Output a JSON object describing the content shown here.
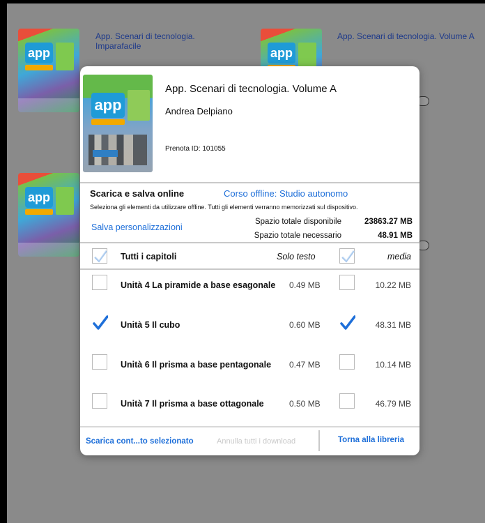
{
  "library": {
    "books": [
      {
        "title": "App. Scenari di tecnologia. Imparafacile"
      },
      {
        "title": "App. Scenari di tecnologia. Volume A"
      }
    ]
  },
  "modal": {
    "book": {
      "title": "App. Scenari di tecnologia. Volume A",
      "author": "Andrea Delpiano",
      "id_text": "Prenota ID: 101055"
    },
    "sync": {
      "title": "Scarica e salva online",
      "mode_link": "Corso offline: Studio autonomo",
      "description": "Seleziona gli elementi da utilizzare offline. Tutti gli elementi verranno memorizzati sul dispositivo.",
      "save_link": "Salva personalizzazioni",
      "available_label": "Spazio totale disponibile",
      "available_value": "23863.27 MB",
      "needed_label": "Spazio totale necessario",
      "needed_value": "48.91 MB"
    },
    "columns": {
      "all_chapters": "Tutti i capitoli",
      "text_only": "Solo testo",
      "media": "media"
    },
    "chapters": [
      {
        "label": "Unità 4 La piramide a base esagonale",
        "text_size": "0.49 MB",
        "media_size": "10.22 MB",
        "text_checked": false,
        "media_checked": false
      },
      {
        "label": "Unità 5 Il cubo",
        "text_size": "0.60 MB",
        "media_size": "48.31 MB",
        "text_checked": true,
        "media_checked": true
      },
      {
        "label": "Unità 6 Il prisma a base pentagonale",
        "text_size": "0.47 MB",
        "media_size": "10.14 MB",
        "text_checked": false,
        "media_checked": false
      },
      {
        "label": "Unità 7 Il prisma a base ottagonale",
        "text_size": "0.50 MB",
        "media_size": "46.79 MB",
        "text_checked": false,
        "media_checked": false
      }
    ],
    "footer": {
      "download_selected": "Scarica cont...to selezionato",
      "cancel_all": "Annulla tutti i download",
      "back_library": "Torna alla libreria"
    },
    "colors": {
      "accent": "#1e6fd9",
      "check": "#1e6fd9",
      "disabled": "#c9c9c9"
    }
  }
}
